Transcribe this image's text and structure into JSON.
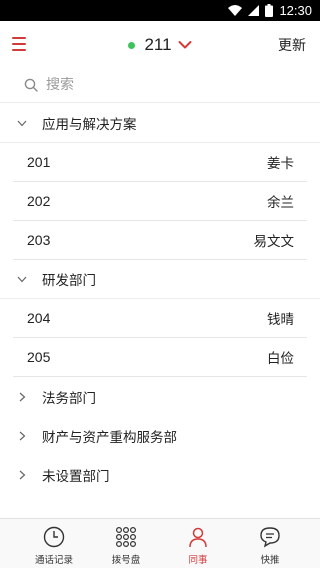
{
  "status_bar": {
    "time": "12:30",
    "icons": [
      "wifi-icon",
      "signal-icon",
      "battery-icon"
    ]
  },
  "header": {
    "menu_icon": "hamburger-menu-icon",
    "status_indicator_color": "#3cc35c",
    "extension": "211",
    "dropdown_icon": "chevron-down-icon",
    "update_label": "更新"
  },
  "search": {
    "icon": "search-icon",
    "placeholder": "搜索",
    "value": ""
  },
  "groups": [
    {
      "label": "应用与解决方案",
      "expanded": true,
      "members": [
        {
          "ext": "201",
          "name": "姜卡"
        },
        {
          "ext": "202",
          "name": "余兰"
        },
        {
          "ext": "203",
          "name": "易文文"
        }
      ]
    },
    {
      "label": "研发部门",
      "expanded": true,
      "members": [
        {
          "ext": "204",
          "name": "钱晴"
        },
        {
          "ext": "205",
          "name": "白俭"
        }
      ]
    },
    {
      "label": "法务部门",
      "expanded": false,
      "members": []
    },
    {
      "label": "财产与资产重构服务部",
      "expanded": false,
      "members": []
    },
    {
      "label": "未设置部门",
      "expanded": false,
      "members": []
    }
  ],
  "tabs": [
    {
      "label": "通话记录",
      "icon": "clock-icon",
      "active": false
    },
    {
      "label": "拨号盘",
      "icon": "dialpad-icon",
      "active": false
    },
    {
      "label": "同事",
      "icon": "contacts-icon",
      "active": true
    },
    {
      "label": "快推",
      "icon": "chat-bubble-icon",
      "active": false
    }
  ],
  "colors": {
    "accent": "#d33a3a",
    "online": "#3cc35c",
    "divider": "#e6e6e6"
  }
}
